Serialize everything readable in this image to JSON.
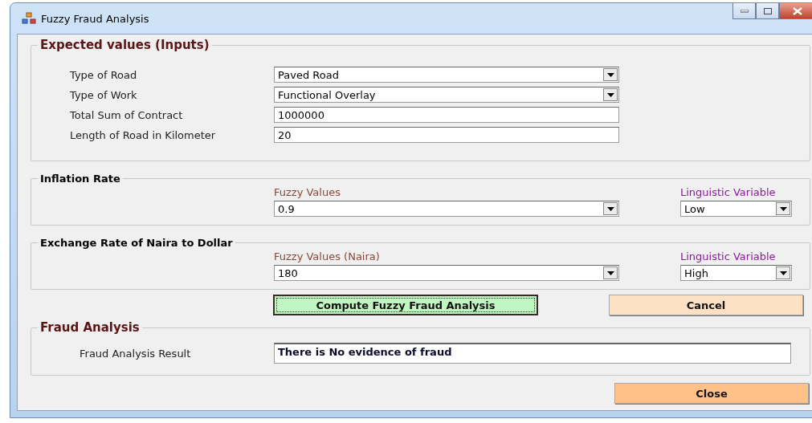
{
  "window": {
    "title": "Fuzzy Fraud Analysis"
  },
  "inputs": {
    "title": "Expected values (Inputs)",
    "fields": [
      {
        "label": "Type of Road",
        "kind": "dropdown",
        "value": "Paved Road"
      },
      {
        "label": "Type of Work",
        "kind": "dropdown",
        "value": "Functional Overlay"
      },
      {
        "label": "Total Sum of Contract",
        "kind": "text",
        "value": "1000000"
      },
      {
        "label": "Length of Road in Kilometer",
        "kind": "text",
        "value": "20"
      }
    ]
  },
  "rate_groups": [
    {
      "title": "Inflation Rate",
      "fuzzy_label": "Fuzzy Values",
      "fuzzy_value": "0.9",
      "linguistic_label": "Linguistic Variable",
      "linguistic_value": "Low"
    },
    {
      "title": "Exchange Rate of Naira to Dollar",
      "fuzzy_label": "Fuzzy Values (Naira)",
      "fuzzy_value": "180",
      "linguistic_label": "Linguistic Variable",
      "linguistic_value": "High"
    }
  ],
  "buttons": [
    {
      "label": "Compute Fuzzy Fraud Analysis",
      "kind": "compute",
      "focused": true
    },
    {
      "label": "Cancel",
      "kind": "cancel",
      "focused": false
    }
  ],
  "fraud": {
    "title": "Fraud Analysis",
    "label": "Fraud Analysis Result",
    "value": "There is No evidence of fraud"
  },
  "close_button": {
    "label": "Close"
  }
}
